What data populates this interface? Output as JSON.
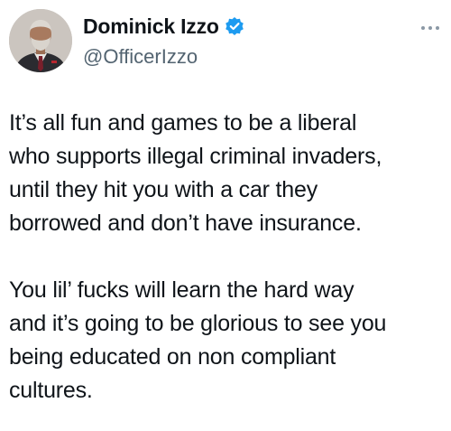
{
  "author": {
    "display_name": "Dominick Izzo",
    "handle": "@OfficerIzzo",
    "verified_icon": "verified-badge-icon",
    "avatar_icon": "profile-photo",
    "verified_color": "#1d9bf0"
  },
  "menu": {
    "icon": "more-options-icon"
  },
  "tweet": {
    "paragraphs": [
      {
        "lines": [
          "It’s all fun and games to be a liberal",
          "who supports illegal criminal invaders,",
          "until they hit you with a car they",
          "borrowed and don’t have insurance."
        ]
      },
      {
        "lines": [
          "You lil’ fucks will learn the hard way",
          "and it’s going to be glorious to see you",
          "being educated on non compliant",
          "cultures."
        ]
      }
    ]
  }
}
